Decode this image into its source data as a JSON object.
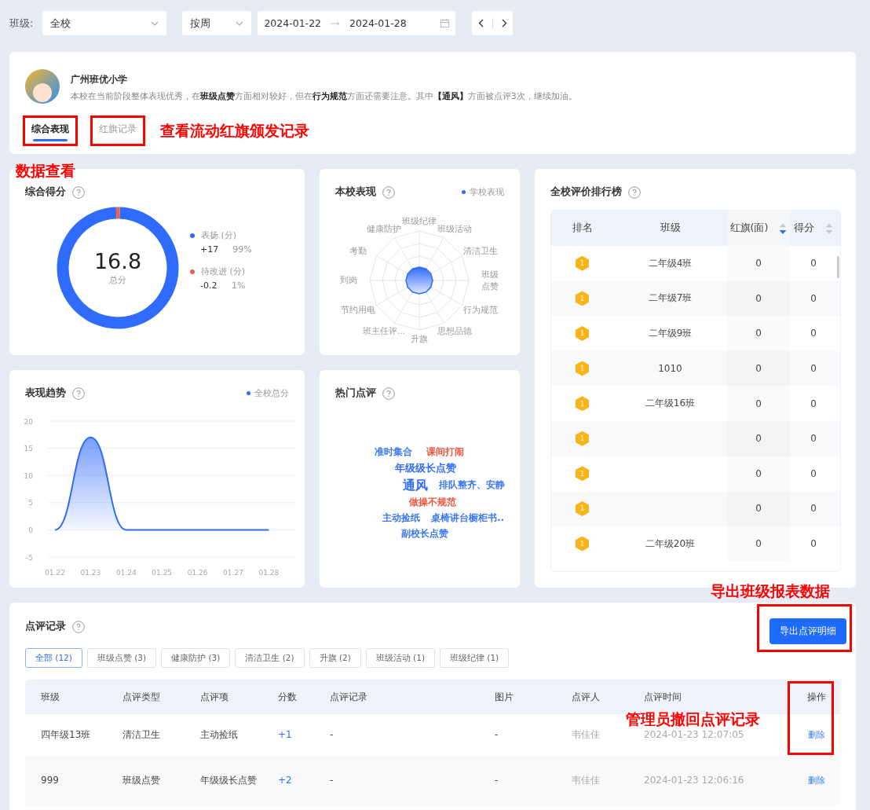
{
  "filters": {
    "class_label": "班级:",
    "class_value": "全校",
    "period_value": "按周",
    "date_start": "2024-01-22",
    "date_end": "2024-01-28"
  },
  "school": {
    "name": "广州班优小学",
    "summary": "本校在当前阶段整体表现优秀，在**班级点赞**方面相对较好，但在**行为规范**方面还需要注意。其中**【通风】**方面被点评3次，继续加油。"
  },
  "tabs": [
    {
      "label": "综合表现",
      "selected": true,
      "highlighted": true
    },
    {
      "label": "红旗记录",
      "selected": false,
      "highlighted": true
    }
  ],
  "annotations": [
    {
      "text": "查看流动红旗颁发记录"
    },
    {
      "text": "数据查看"
    },
    {
      "text": "导出班级报表数据"
    },
    {
      "text": "管理员撤回点评记录"
    }
  ],
  "score_card": {
    "title": "综合得分",
    "total": "16.8",
    "total_label": "总分",
    "legend": [
      {
        "value": "+17",
        "percent": "99%",
        "color": "#2f6bff"
      },
      {
        "value": "-0.2",
        "percent": "1%",
        "color": "#f0604a"
      }
    ],
    "chart_data": {
      "type": "donut",
      "categories": [
        "表扬 (分)",
        "待改进 (分)"
      ],
      "values": [
        99,
        1
      ],
      "colors": [
        "#2f6bff",
        "#f0604a"
      ]
    }
  },
  "radar_card": {
    "title": "本校表现",
    "legend": "学校表现",
    "axes": [
      "班级纪律",
      "健康防护",
      "班级活动",
      "考勤",
      "清洁卫生",
      "到岗",
      "班级点赞",
      "节约用电",
      "行为规范",
      "班主任评...",
      "思想品德",
      "升旗"
    ]
  },
  "trend_card": {
    "title": "表现趋势",
    "chart_data": {
      "type": "area",
      "categories": [
        "01.22",
        "01.23",
        "01.24",
        "01.25",
        "01.26",
        "01.27",
        "01.28"
      ],
      "series": [
        {
          "name": "全校总分",
          "color": "#2f6bff",
          "values": [
            0,
            17,
            0,
            0,
            0,
            0,
            0
          ]
        }
      ],
      "ylim": [
        -5,
        20
      ],
      "yticks": [
        -5,
        0,
        5,
        10,
        15,
        20
      ],
      "grid": true
    }
  },
  "hot_card": {
    "title": "热门点评",
    "words": [
      {
        "text": "准时集合",
        "color": "#3a78f2",
        "kind": "small"
      },
      {
        "text": "课间打闹",
        "color": "#f0533c",
        "kind": "small"
      },
      {
        "text": "年级级长点赞",
        "color": "#2f6bff",
        "kind": "medium"
      },
      {
        "text": "通风",
        "color": "#2f6bff",
        "kind": "large"
      },
      {
        "text": "排队整齐、安静",
        "color": "#3a78f2",
        "kind": "small"
      },
      {
        "text": "做操不规范",
        "color": "#f0533c",
        "kind": "small"
      },
      {
        "text": "主动捡纸",
        "color": "#3a78f2",
        "kind": "small"
      },
      {
        "text": "桌椅讲台橱柜书..",
        "color": "#3a78f2",
        "kind": "small"
      },
      {
        "text": "副校长点赞",
        "color": "#3a78f2",
        "kind": "small"
      }
    ]
  },
  "ranking": {
    "title": "全校评价排行榜",
    "columns": [
      {
        "label": "排名"
      },
      {
        "label": "班级"
      },
      {
        "label": "红旗(面)",
        "sortable": true,
        "sorted_desc": true
      },
      {
        "label": "得分",
        "sortable": true,
        "sorted_desc": false
      }
    ],
    "rows": [
      {
        "rank": "1",
        "class": "二年级4班",
        "flags": "0",
        "score": "0"
      },
      {
        "rank": "1",
        "class": "二年级7班",
        "flags": "0",
        "score": "0"
      },
      {
        "rank": "1",
        "class": "二年级9班",
        "flags": "0",
        "score": "0"
      },
      {
        "rank": "1",
        "class": "1010",
        "flags": "0",
        "score": "0"
      },
      {
        "rank": "1",
        "class": "二年级16班",
        "flags": "0",
        "score": "0"
      },
      {
        "rank": "1",
        "flags": "0",
        "score": "0"
      },
      {
        "rank": "1",
        "flags": "0",
        "score": "0"
      },
      {
        "rank": "1",
        "flags": "0",
        "score": "0"
      },
      {
        "rank": "1",
        "class": "二年级20班",
        "flags": "0",
        "score": "0"
      }
    ]
  },
  "records": {
    "title": "点评记录",
    "export_button": {
      "label": "导出点评明细",
      "highlighted": true
    },
    "chips": [
      {
        "label": "全部 (12)",
        "selected": true
      },
      {
        "label": "班级点赞 (3)",
        "selected": false
      },
      {
        "label": "健康防护 (3)",
        "selected": false
      },
      {
        "label": "清洁卫生 (2)",
        "selected": false
      },
      {
        "label": "升旗 (2)",
        "selected": false
      },
      {
        "label": "班级活动 (1)",
        "selected": false
      },
      {
        "label": "班级纪律 (1)",
        "selected": false
      }
    ],
    "columns": [
      {
        "label": "班级"
      },
      {
        "label": "点评类型"
      },
      {
        "label": "点评项"
      },
      {
        "label": "分数"
      },
      {
        "label": "点评记录"
      },
      {
        "label": "图片"
      },
      {
        "label": "点评人"
      },
      {
        "label": "点评时间"
      },
      {
        "label": "操作",
        "highlighted": true
      }
    ],
    "rows": [
      {
        "class": "四年级13班",
        "type": "清洁卫生",
        "item": "主动捡纸",
        "score": "+1",
        "record": "-",
        "image": "-",
        "reviewer": "韦佳佳",
        "time": "2024-01-23 12:07:05",
        "action": "删除"
      },
      {
        "class": "999",
        "type": "班级点赞",
        "item": "年级级长点赞",
        "score": "+2",
        "record": "-",
        "image": "-",
        "reviewer": "韦佳佳",
        "time": "2024-01-23 12:06:16",
        "action": "删除"
      }
    ]
  }
}
